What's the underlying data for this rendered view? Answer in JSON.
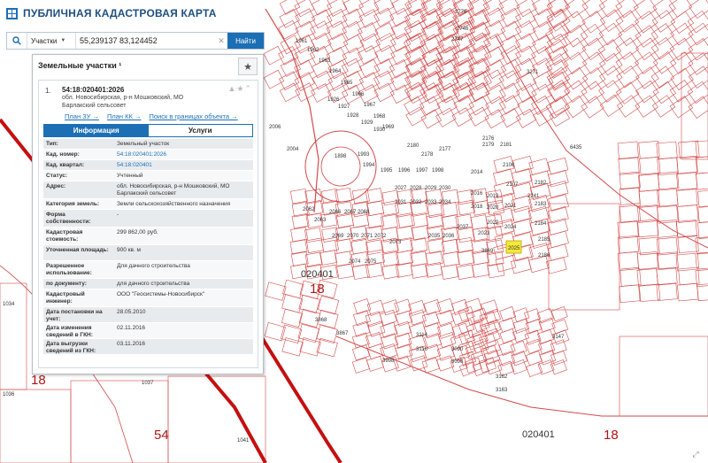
{
  "app": {
    "title": "ПУБЛИЧНАЯ КАДАСТРОВАЯ КАРТА"
  },
  "search": {
    "type_label": "Участки",
    "query": "55,239137 83,124452",
    "button_label": "Найти"
  },
  "panel": {
    "heading": "Земельные участки ¹",
    "result": {
      "index": "1.",
      "cad_number": "54:18:020401:2026",
      "address_line1": "обл. Новосибирская, р-н Мошковский, МО",
      "address_line2": "Барлакский сельсовет",
      "links": [
        "План ЗУ →",
        "План КК →",
        "Поиск в границах объекта →"
      ],
      "tabs": {
        "info": "Информация",
        "services": "Услуги"
      },
      "fields": [
        {
          "key": "Тип:",
          "value": "Земельный участок",
          "link": false,
          "h": 12
        },
        {
          "key": "Кад. номер:",
          "value": "54:18:020401:2026",
          "link": true,
          "h": 12
        },
        {
          "key": "Кад. квартал:",
          "value": "54:18:020401",
          "link": true,
          "h": 12
        },
        {
          "key": "Статус:",
          "value": "Учтенный",
          "link": false,
          "h": 12
        },
        {
          "key": "Адрес:",
          "value": "обл. Новосибирская, р-н Мошковский, МО Барлакский сельсовет",
          "link": false,
          "h": 20
        },
        {
          "key": "Категория земель:",
          "value": "Земли сельскохозяйственного назначения",
          "link": false,
          "h": 12
        },
        {
          "key": "Форма собственности:",
          "value": "-",
          "link": false,
          "h": 20
        },
        {
          "key": "Кадастровая стоимость:",
          "value": "299 862,00 руб.",
          "link": false,
          "h": 20
        },
        {
          "key": "Уточненная площадь:",
          "value": "900 кв. м",
          "link": false,
          "h": 18
        },
        {
          "key": "Разрешенное использование:",
          "value": "Для дачного строительства",
          "link": false,
          "h": 20
        },
        {
          "key": "по документу:",
          "value": "для дачного строительства",
          "link": false,
          "h": 12
        },
        {
          "key": "Кадастровый инженер:",
          "value": "ООО \"Геосистемы-Новосибирск\"",
          "link": false,
          "h": 20
        },
        {
          "key": "Дата постановки на учет:",
          "value": "28.05.2010",
          "link": false,
          "h": 18
        },
        {
          "key": "Дата изменения сведений в ГКН:",
          "value": "02.11.2016",
          "link": false,
          "h": 18
        },
        {
          "key": "Дата выгрузки сведений из ГКН:",
          "value": "03.11.2016",
          "link": false,
          "h": 18
        }
      ]
    }
  },
  "map": {
    "big_labels": [
      "54",
      "18",
      "020401",
      "18",
      "020401",
      "18"
    ],
    "parcel_labels": [
      "1961",
      "1962",
      "1963",
      "1964",
      "1965",
      "1966",
      "1967",
      "1968",
      "1969",
      "2006",
      "2004",
      "2062",
      "2063",
      "2066",
      "2067",
      "2068",
      "2069",
      "2070",
      "2071",
      "2072",
      "2073",
      "2074",
      "2075",
      "2027",
      "2028",
      "2029",
      "2030",
      "2031",
      "2032",
      "2033",
      "2034",
      "2035",
      "2036",
      "2037",
      "2014",
      "2016",
      "2018",
      "2019",
      "2020",
      "2021",
      "2022",
      "2023",
      "2024",
      "2106",
      "2107",
      "2182",
      "2183",
      "2184",
      "2185",
      "2186",
      "2181",
      "2176",
      "2179",
      "3998",
      "3271",
      "3869",
      "3868",
      "3867",
      "1034",
      "1036",
      "1037",
      "1041",
      "3147",
      "3162",
      "3163",
      "3114",
      "3116",
      "3096",
      "3090",
      "2241",
      "2776",
      "2746",
      "2747",
      "6435",
      "1994",
      "1995",
      "1996",
      "1997",
      "1998",
      "1993",
      "1926",
      "1927",
      "1928",
      "1929",
      "1930",
      "2180",
      "2178",
      "2177"
    ],
    "highlight_label": "2025",
    "ring_label": "1898",
    "zoom_label": "⤢"
  },
  "colors": {
    "parcel_line": "#d24a4a",
    "boundary": "#c41010",
    "highlight": "#f3ea3a",
    "accent": "#1c6fb5"
  }
}
